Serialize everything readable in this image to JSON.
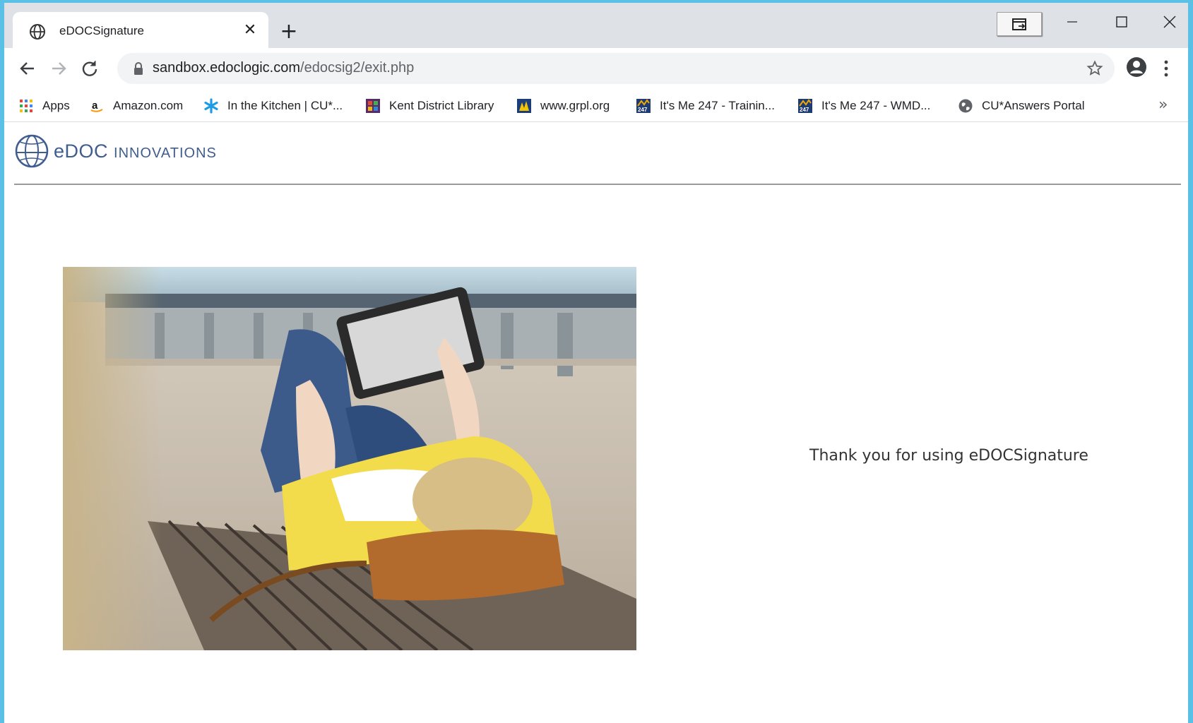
{
  "browser": {
    "tab": {
      "title": "eDOCSignature",
      "favicon": "globe-icon"
    },
    "address": {
      "host": "sandbox.edoclogic.com",
      "path": "/edocsig2/exit.php"
    },
    "bookmarks": [
      {
        "label": "Apps",
        "icon": "apps-grid-icon"
      },
      {
        "label": "Amazon.com",
        "icon": "amazon-icon"
      },
      {
        "label": "In the Kitchen | CU*...",
        "icon": "asterisk-icon"
      },
      {
        "label": "Kent District Library",
        "icon": "kdl-icon"
      },
      {
        "label": "www.grpl.org",
        "icon": "grpl-icon"
      },
      {
        "label": "It's Me 247 - Trainin...",
        "icon": "itsme247-icon"
      },
      {
        "label": "It's Me 247 - WMD...",
        "icon": "itsme247-icon"
      },
      {
        "label": "CU*Answers Portal",
        "icon": "globe-icon"
      }
    ],
    "more_bookmarks": "»"
  },
  "page": {
    "logo": {
      "prefix": "eDOC ",
      "name": "Innovations"
    },
    "message": "Thank you for using eDOCSignature",
    "photo_description": "Woman lying on a bench reading a tablet"
  },
  "colors": {
    "desktop_bg": "#5bc0e6",
    "tabstrip_bg": "#dee1e6",
    "logo_blue": "#3f5d8f"
  }
}
